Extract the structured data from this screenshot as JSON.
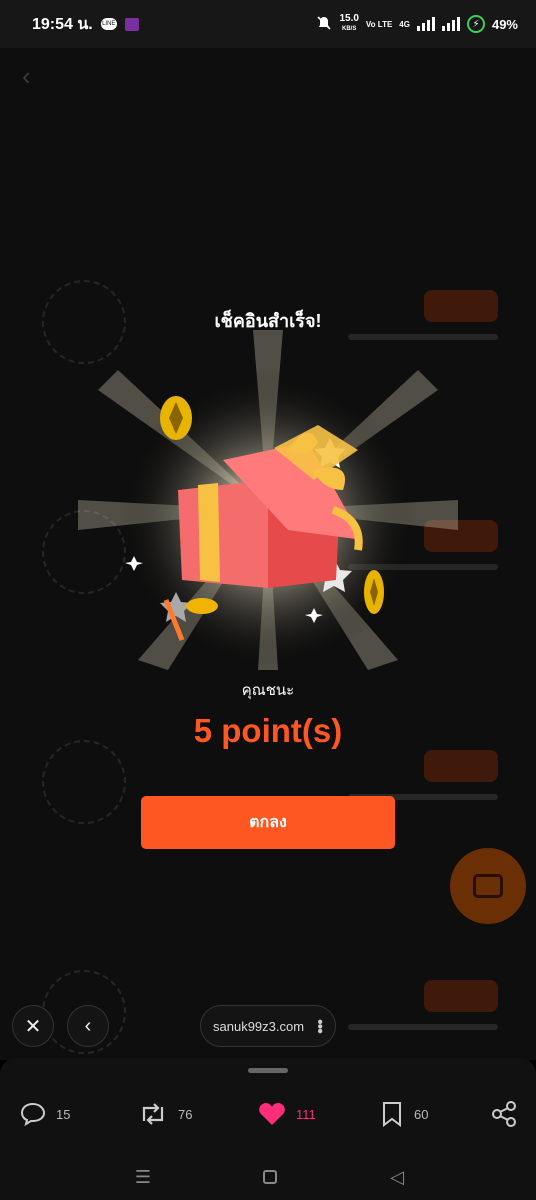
{
  "status_bar": {
    "time": "19:54 น.",
    "notif_line": "LINE",
    "net_rate_value": "15.0",
    "net_rate_unit": "KB/S",
    "volte": "Vo LTE",
    "network": "4G",
    "battery": "49%"
  },
  "modal": {
    "title": "เช็คอินสำเร็จ!",
    "win_label": "คุณชนะ",
    "points": "5 point(s)",
    "ok_button": "ตกลง"
  },
  "browser": {
    "url": "sanuk99z3.com"
  },
  "actions": {
    "comments": "15",
    "reposts": "76",
    "likes": "111",
    "bookmarks": "60"
  },
  "colors": {
    "accent": "#ff5722",
    "like": "#ff2d7a",
    "battery": "#3ecf5a"
  }
}
